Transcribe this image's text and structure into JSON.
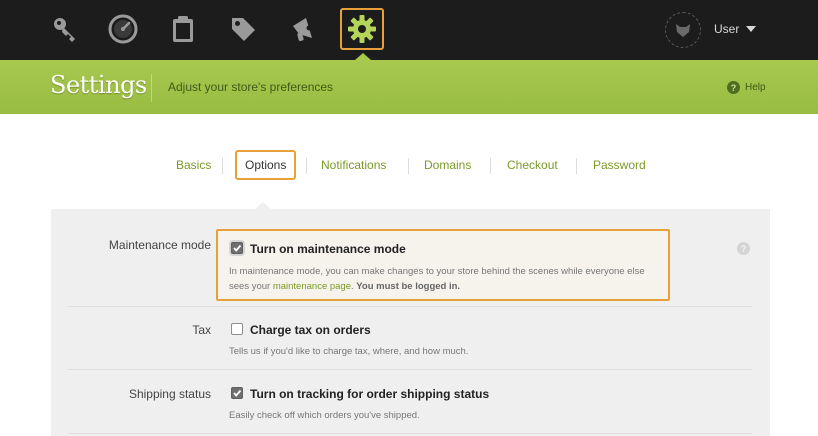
{
  "topnav": {
    "icons": [
      "key-icon",
      "dashboard-gauge-icon",
      "clipboard-icon",
      "tag-icon",
      "megaphone-icon",
      "gear-icon"
    ],
    "active_icon": "gear-icon",
    "user": {
      "label": "User",
      "avatar_icon": "fox-head-icon"
    }
  },
  "header": {
    "title": "Settings",
    "subtitle": "Adjust your store's preferences",
    "help_label": "Help",
    "help_icon_glyph": "?"
  },
  "tabs": [
    {
      "label": "Basics",
      "active": false
    },
    {
      "label": "Options",
      "active": true
    },
    {
      "label": "Notifications",
      "active": false
    },
    {
      "label": "Domains",
      "active": false
    },
    {
      "label": "Checkout",
      "active": false
    },
    {
      "label": "Password",
      "active": false
    }
  ],
  "settings": {
    "maintenance": {
      "label": "Maintenance mode",
      "option": "Turn on maintenance mode",
      "checked": true,
      "desc_pre": "In maintenance mode, you can make changes to your store behind the scenes while everyone else sees your ",
      "desc_link": "maintenance page",
      "desc_mid": ". ",
      "desc_strong": "You must be logged in.",
      "help_glyph": "?"
    },
    "tax": {
      "label": "Tax",
      "option": "Charge tax on orders",
      "checked": false,
      "desc": "Tells us if you'd like to charge tax, where, and how much."
    },
    "shipping": {
      "label": "Shipping status",
      "option": "Turn on tracking for order shipping status",
      "checked": true,
      "desc": "Easily check off which orders you've shipped."
    }
  },
  "colors": {
    "accent": "#e8a13a",
    "header_green": "#a8c94f",
    "link_green": "#7a9a28",
    "topbar": "#1c1c1c",
    "panel": "#efefef"
  }
}
